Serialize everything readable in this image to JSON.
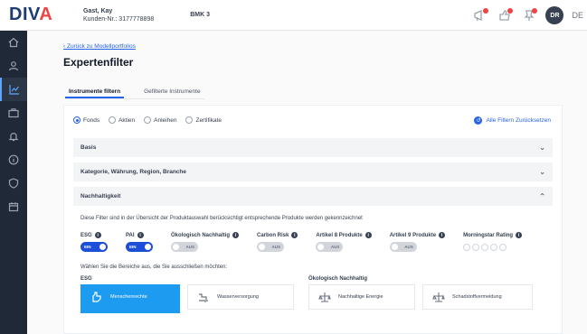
{
  "header": {
    "logo_main": "DIV",
    "logo_accent": "A",
    "user_name": "Gast, Kay",
    "customer_number": "Kunden-Nr.: 3177778898",
    "bank_id": "BMK 3",
    "avatar_initials": "DR",
    "language": "DE"
  },
  "sidebar": {
    "items": [
      {
        "icon": "home-icon"
      },
      {
        "icon": "user-icon"
      },
      {
        "icon": "chart-icon",
        "active": true
      },
      {
        "icon": "briefcase-icon"
      },
      {
        "icon": "bell-icon"
      },
      {
        "icon": "info-icon"
      },
      {
        "icon": "shield-icon"
      },
      {
        "icon": "calendar-icon"
      }
    ]
  },
  "page": {
    "back_link": "‹ Zurück zu Modellportfolios",
    "title": "Expertenfilter"
  },
  "tabs": [
    {
      "label": "Instrumente filtern",
      "active": true
    },
    {
      "label": "Gefilterte Instrumente",
      "active": false
    }
  ],
  "radios": [
    {
      "label": "Fonds",
      "checked": true
    },
    {
      "label": "Aktien",
      "checked": false
    },
    {
      "label": "Anleihen",
      "checked": false
    },
    {
      "label": "Zertifikate",
      "checked": false
    }
  ],
  "reset_label": "Alle Filtern Zurücksetzen",
  "accordions": [
    {
      "label": "Basis",
      "chevron": "⌄"
    },
    {
      "label": "Kategorie, Währung, Region, Branche",
      "chevron": "⌄"
    },
    {
      "label": "Nachhaltigkeit",
      "chevron": "⌃"
    }
  ],
  "nachhaltigkeit": {
    "description": "Diese Filter sind in der Übersicht der Produktauswahl berücksichtigt entsprechende Produkte werden gekennzeichnet",
    "toggles": [
      {
        "label": "ESG",
        "state": "on",
        "state_label": "EIN"
      },
      {
        "label": "PAI",
        "state": "on",
        "state_label": "EIN"
      },
      {
        "label": "Ökologisch Nachhaltig",
        "state": "off",
        "state_label": "AUS"
      },
      {
        "label": "Carbon Risk",
        "state": "off",
        "state_label": "AUS"
      },
      {
        "label": "Artikel 8 Produkte",
        "state": "off",
        "state_label": "AUS"
      },
      {
        "label": "Artikel 9 Produkte",
        "state": "off",
        "state_label": "AUS"
      }
    ],
    "rating_label": "Morningstar Rating",
    "rating_value": 0,
    "rating_max": 5,
    "question": "Wählen Sie die Bereiche aus, die Sie ausschließen möchten:",
    "section_esg": "ESG",
    "section_oeko": "Ökologisch Nachhaltig",
    "tiles": [
      {
        "label": "Menschenrechte",
        "icon": "hand-icon",
        "selected": true
      },
      {
        "label": "Wasserversorgung",
        "icon": "water-icon",
        "selected": false
      },
      {
        "label": "Nachhaltige Energie",
        "icon": "scale-icon",
        "selected": false
      },
      {
        "label": "Schadstoffvermeidung",
        "icon": "scale-icon",
        "selected": false
      }
    ]
  },
  "colors": {
    "brand": "#1f3b73",
    "accent": "#ef4444",
    "primary": "#2563eb",
    "sidebar": "#1f2937",
    "selected_tile": "#1d9bf0"
  }
}
